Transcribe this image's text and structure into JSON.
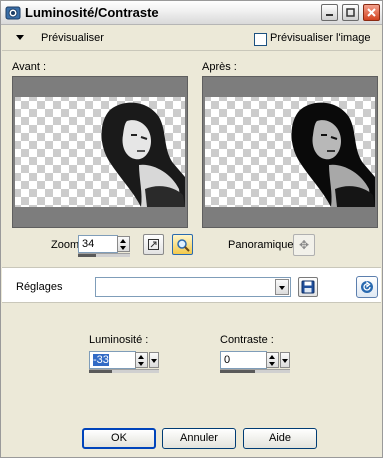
{
  "window": {
    "title": "Luminosité/Contraste"
  },
  "preview": {
    "toggle_label": "Prévisualiser",
    "preview_image_label": "Prévisualiser l'image",
    "preview_image_checked": false
  },
  "panes": {
    "before_label": "Avant :",
    "after_label": "Après :"
  },
  "zoom": {
    "label": "Zoom :",
    "value": "34",
    "slider_fraction": 0.34
  },
  "pan": {
    "label": "Panoramique :"
  },
  "settings": {
    "label": "Réglages",
    "value": ""
  },
  "params": {
    "brightness": {
      "label": "Luminosité :",
      "value": "-33",
      "slider_fraction": 0.335
    },
    "contrast": {
      "label": "Contraste :",
      "value": "0",
      "slider_fraction": 0.5
    }
  },
  "buttons": {
    "ok": "OK",
    "cancel": "Annuler",
    "help": "Aide"
  },
  "icons": {
    "collapse": "triangle-down-icon",
    "zoom_fit": "fit-to-window-icon",
    "zoom_magnifier": "magnifier-icon",
    "pan": "move-cross-icon",
    "save": "floppy-disk-icon",
    "reset": "reset-arrow-icon"
  },
  "colors": {
    "window_bg": "#ece9d8",
    "close_button": "#d2421f",
    "accent": "#0044bb"
  }
}
